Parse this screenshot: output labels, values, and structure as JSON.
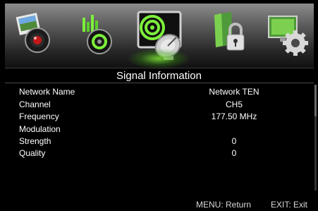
{
  "menu": {
    "items": [
      {
        "icon": "photo-camera-icon"
      },
      {
        "icon": "media-player-icon"
      },
      {
        "icon": "satellite-signal-icon",
        "selected": true
      },
      {
        "icon": "parental-lock-icon"
      },
      {
        "icon": "settings-gear-icon"
      }
    ]
  },
  "page": {
    "title": "Signal Information"
  },
  "info": [
    {
      "label": "Network Name",
      "value": "Network TEN"
    },
    {
      "label": "Channel",
      "value": "CH5"
    },
    {
      "label": "Frequency",
      "value": "177.50 MHz"
    },
    {
      "label": "Modulation",
      "value": ""
    },
    {
      "label": "Strength",
      "value": "0"
    },
    {
      "label": "Quality",
      "value": "0"
    }
  ],
  "footer": {
    "menu_hint": "MENU: Return",
    "exit_hint": "EXIT: Exit"
  },
  "colors": {
    "accent": "#7cf03a",
    "background": "#000000",
    "text": "#ffffff"
  }
}
